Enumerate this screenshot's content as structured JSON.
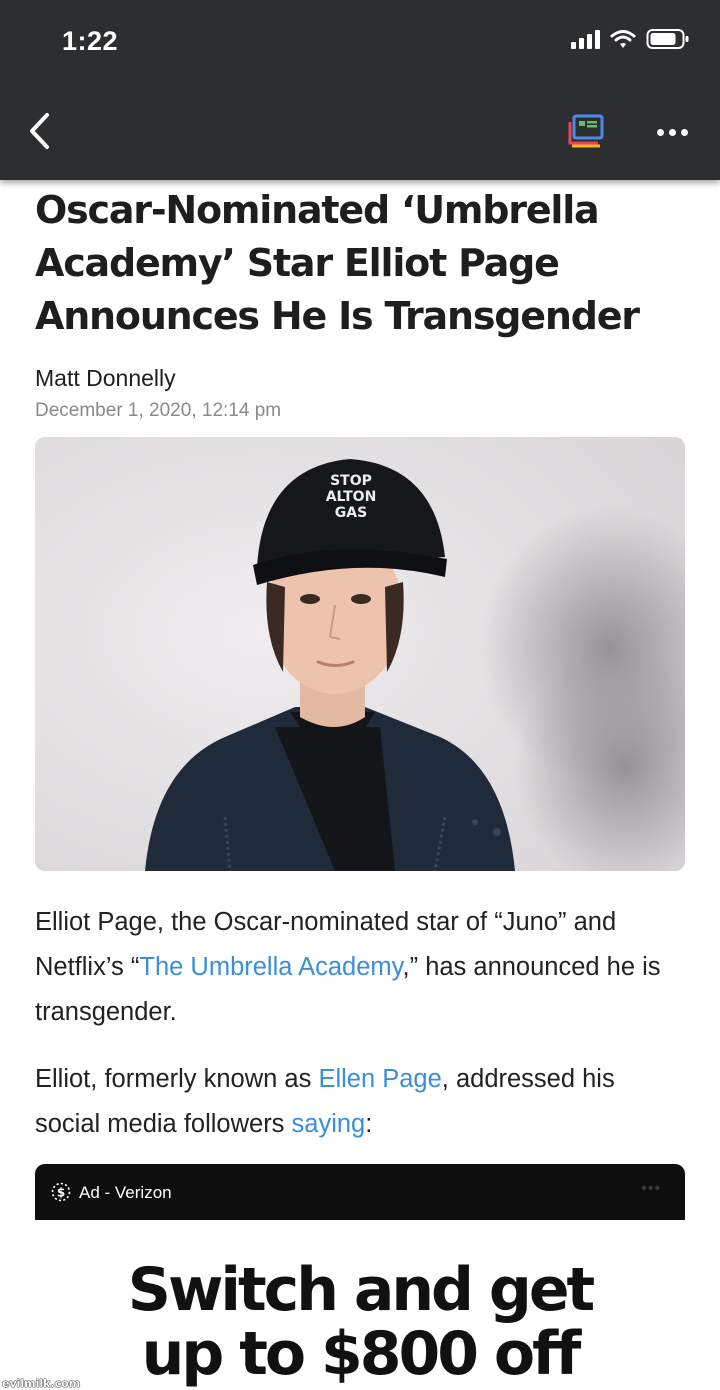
{
  "status_bar": {
    "time": "1:22"
  },
  "nav": {
    "back_icon": "chevron-left-icon",
    "reader_icon": "reader-view-icon",
    "more_icon": "more-horizontal-icon"
  },
  "article": {
    "headline": "Oscar-Nominated ‘Umbrella Academy’ Star Elliot Page Announces He Is Transgender",
    "author": "Matt Donnelly",
    "date": "December 1, 2020, 12:14 pm",
    "hero_image": {
      "cap_text": [
        "STOP",
        "ALTON",
        "GAS"
      ]
    },
    "p1": {
      "before": "Elliot Page, the Oscar-nominated star of “Juno” and Netflix’s “",
      "link": "The Umbrella Academy",
      "after": ",” has announced he is transgender."
    },
    "p2": {
      "before": "Elliot, formerly known as ",
      "link1": "Ellen Page",
      "middle": ", addressed his social media followers ",
      "link2": "saying",
      "after": ":"
    }
  },
  "ad": {
    "label": "Ad - Verizon",
    "more": "•••",
    "headline_line1": "Switch and get",
    "headline_line2": "up to $800 off"
  },
  "watermark": "evilmilk.com"
}
